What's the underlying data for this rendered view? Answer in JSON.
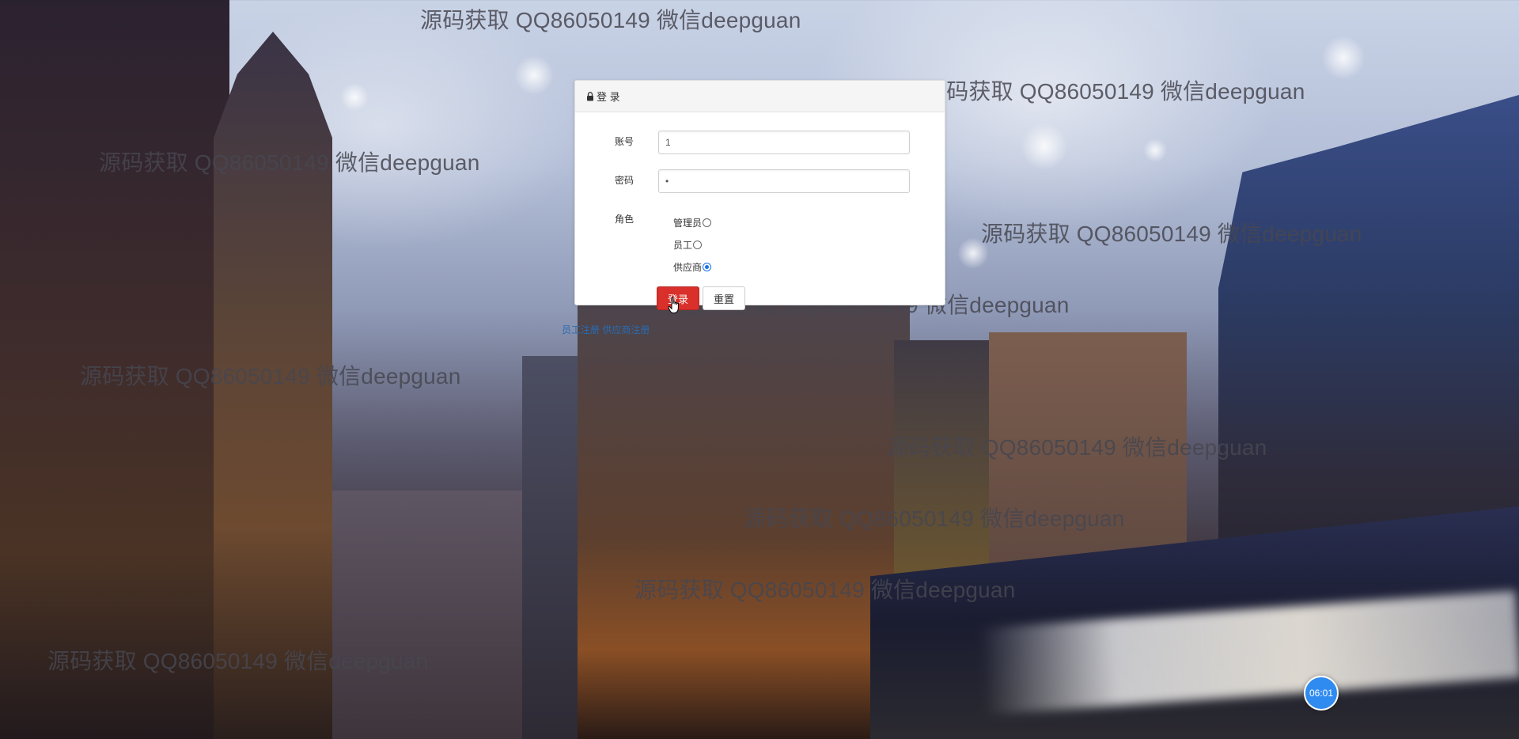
{
  "watermark_text": "源码获取 QQ86050149 微信deepguan",
  "login": {
    "title": "登 录",
    "username_label": "账号",
    "username_value": "1",
    "password_label": "密码",
    "password_value": "•",
    "role_label": "角色",
    "roles": [
      {
        "label": "管理员",
        "checked": false
      },
      {
        "label": "员工",
        "checked": false
      },
      {
        "label": "供应商",
        "checked": true
      }
    ],
    "login_button": "登录",
    "reset_button": "重置"
  },
  "links": {
    "register_employee": "员工注册",
    "register_supplier": "供应商注册"
  },
  "clock": "06:01",
  "colors": {
    "login_button": "#d9302b",
    "clock_badge": "#2f8bf0",
    "link": "#2a6bb3"
  }
}
